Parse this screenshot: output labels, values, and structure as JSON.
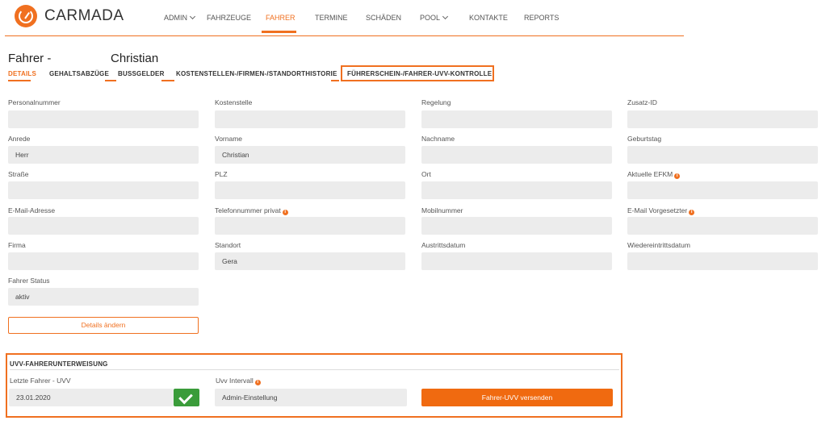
{
  "app": {
    "name": "CARMADA"
  },
  "nav": [
    {
      "label": "ADMIN",
      "dropdown": true
    },
    {
      "label": "FAHRZEUGE"
    },
    {
      "label": "FAHRER",
      "active": true
    },
    {
      "label": "TERMINE"
    },
    {
      "label": "SCHÄDEN"
    },
    {
      "label": "POOL",
      "dropdown": true
    },
    {
      "label": "KONTAKTE"
    },
    {
      "label": "REPORTS"
    }
  ],
  "page": {
    "title_prefix": "Fahrer -",
    "title_name": "Christian"
  },
  "tabs": [
    {
      "label": "DETAILS",
      "active": true
    },
    {
      "label": "GEHALTSABZÜGE"
    },
    {
      "label": "BUSSGELDER"
    },
    {
      "label": "KOSTENSTELLEN-/FIRMEN-/STANDORTHISTORIE"
    },
    {
      "label": "FÜHRERSCHEIN-/FAHRER-UVV-KONTROLLE",
      "highlighted": true
    }
  ],
  "fields": {
    "personalnummer": {
      "label": "Personalnummer",
      "value": ""
    },
    "kostenstelle": {
      "label": "Kostenstelle",
      "value": ""
    },
    "regelung": {
      "label": "Regelung",
      "value": ""
    },
    "zusatz_id": {
      "label": "Zusatz-ID",
      "value": ""
    },
    "anrede": {
      "label": "Anrede",
      "value": "Herr"
    },
    "vorname": {
      "label": "Vorname",
      "value": "Christian"
    },
    "nachname": {
      "label": "Nachname",
      "value": ""
    },
    "geburtstag": {
      "label": "Geburtstag",
      "value": ""
    },
    "strasse": {
      "label": "Straße",
      "value": ""
    },
    "plz": {
      "label": "PLZ",
      "value": ""
    },
    "ort": {
      "label": "Ort",
      "value": ""
    },
    "aktuelle_efkm": {
      "label": "Aktuelle EFKM",
      "value": ""
    },
    "email": {
      "label": "E-Mail-Adresse",
      "value": ""
    },
    "telefon_privat": {
      "label": "Telefonnummer privat",
      "value": ""
    },
    "mobilnummer": {
      "label": "Mobilnummer",
      "value": ""
    },
    "email_vorgesetzter": {
      "label": "E-Mail Vorgesetzter",
      "value": ""
    },
    "firma": {
      "label": "Firma",
      "value": ""
    },
    "standort": {
      "label": "Standort",
      "value": "Gera"
    },
    "austrittsdatum": {
      "label": "Austrittsdatum",
      "value": ""
    },
    "wiedereintrittsdatum": {
      "label": "Wiedereintrittsdatum",
      "value": ""
    },
    "fahrer_status": {
      "label": "Fahrer Status",
      "value": "aktiv"
    }
  },
  "actions": {
    "details_aendern": "Details ändern"
  },
  "uvv": {
    "title": "UVV-FAHRERUNTERWEISUNG",
    "letzte_label": "Letzte Fahrer - UVV",
    "letzte_value": "23.01.2020",
    "intervall_label": "Uvv Intervall",
    "intervall_value": "Admin-Einstellung",
    "send_button": "Fahrer-UVV versenden"
  },
  "icons": {
    "info": "i"
  },
  "colors": {
    "accent": "#f07020",
    "success": "#3a9c3a"
  }
}
